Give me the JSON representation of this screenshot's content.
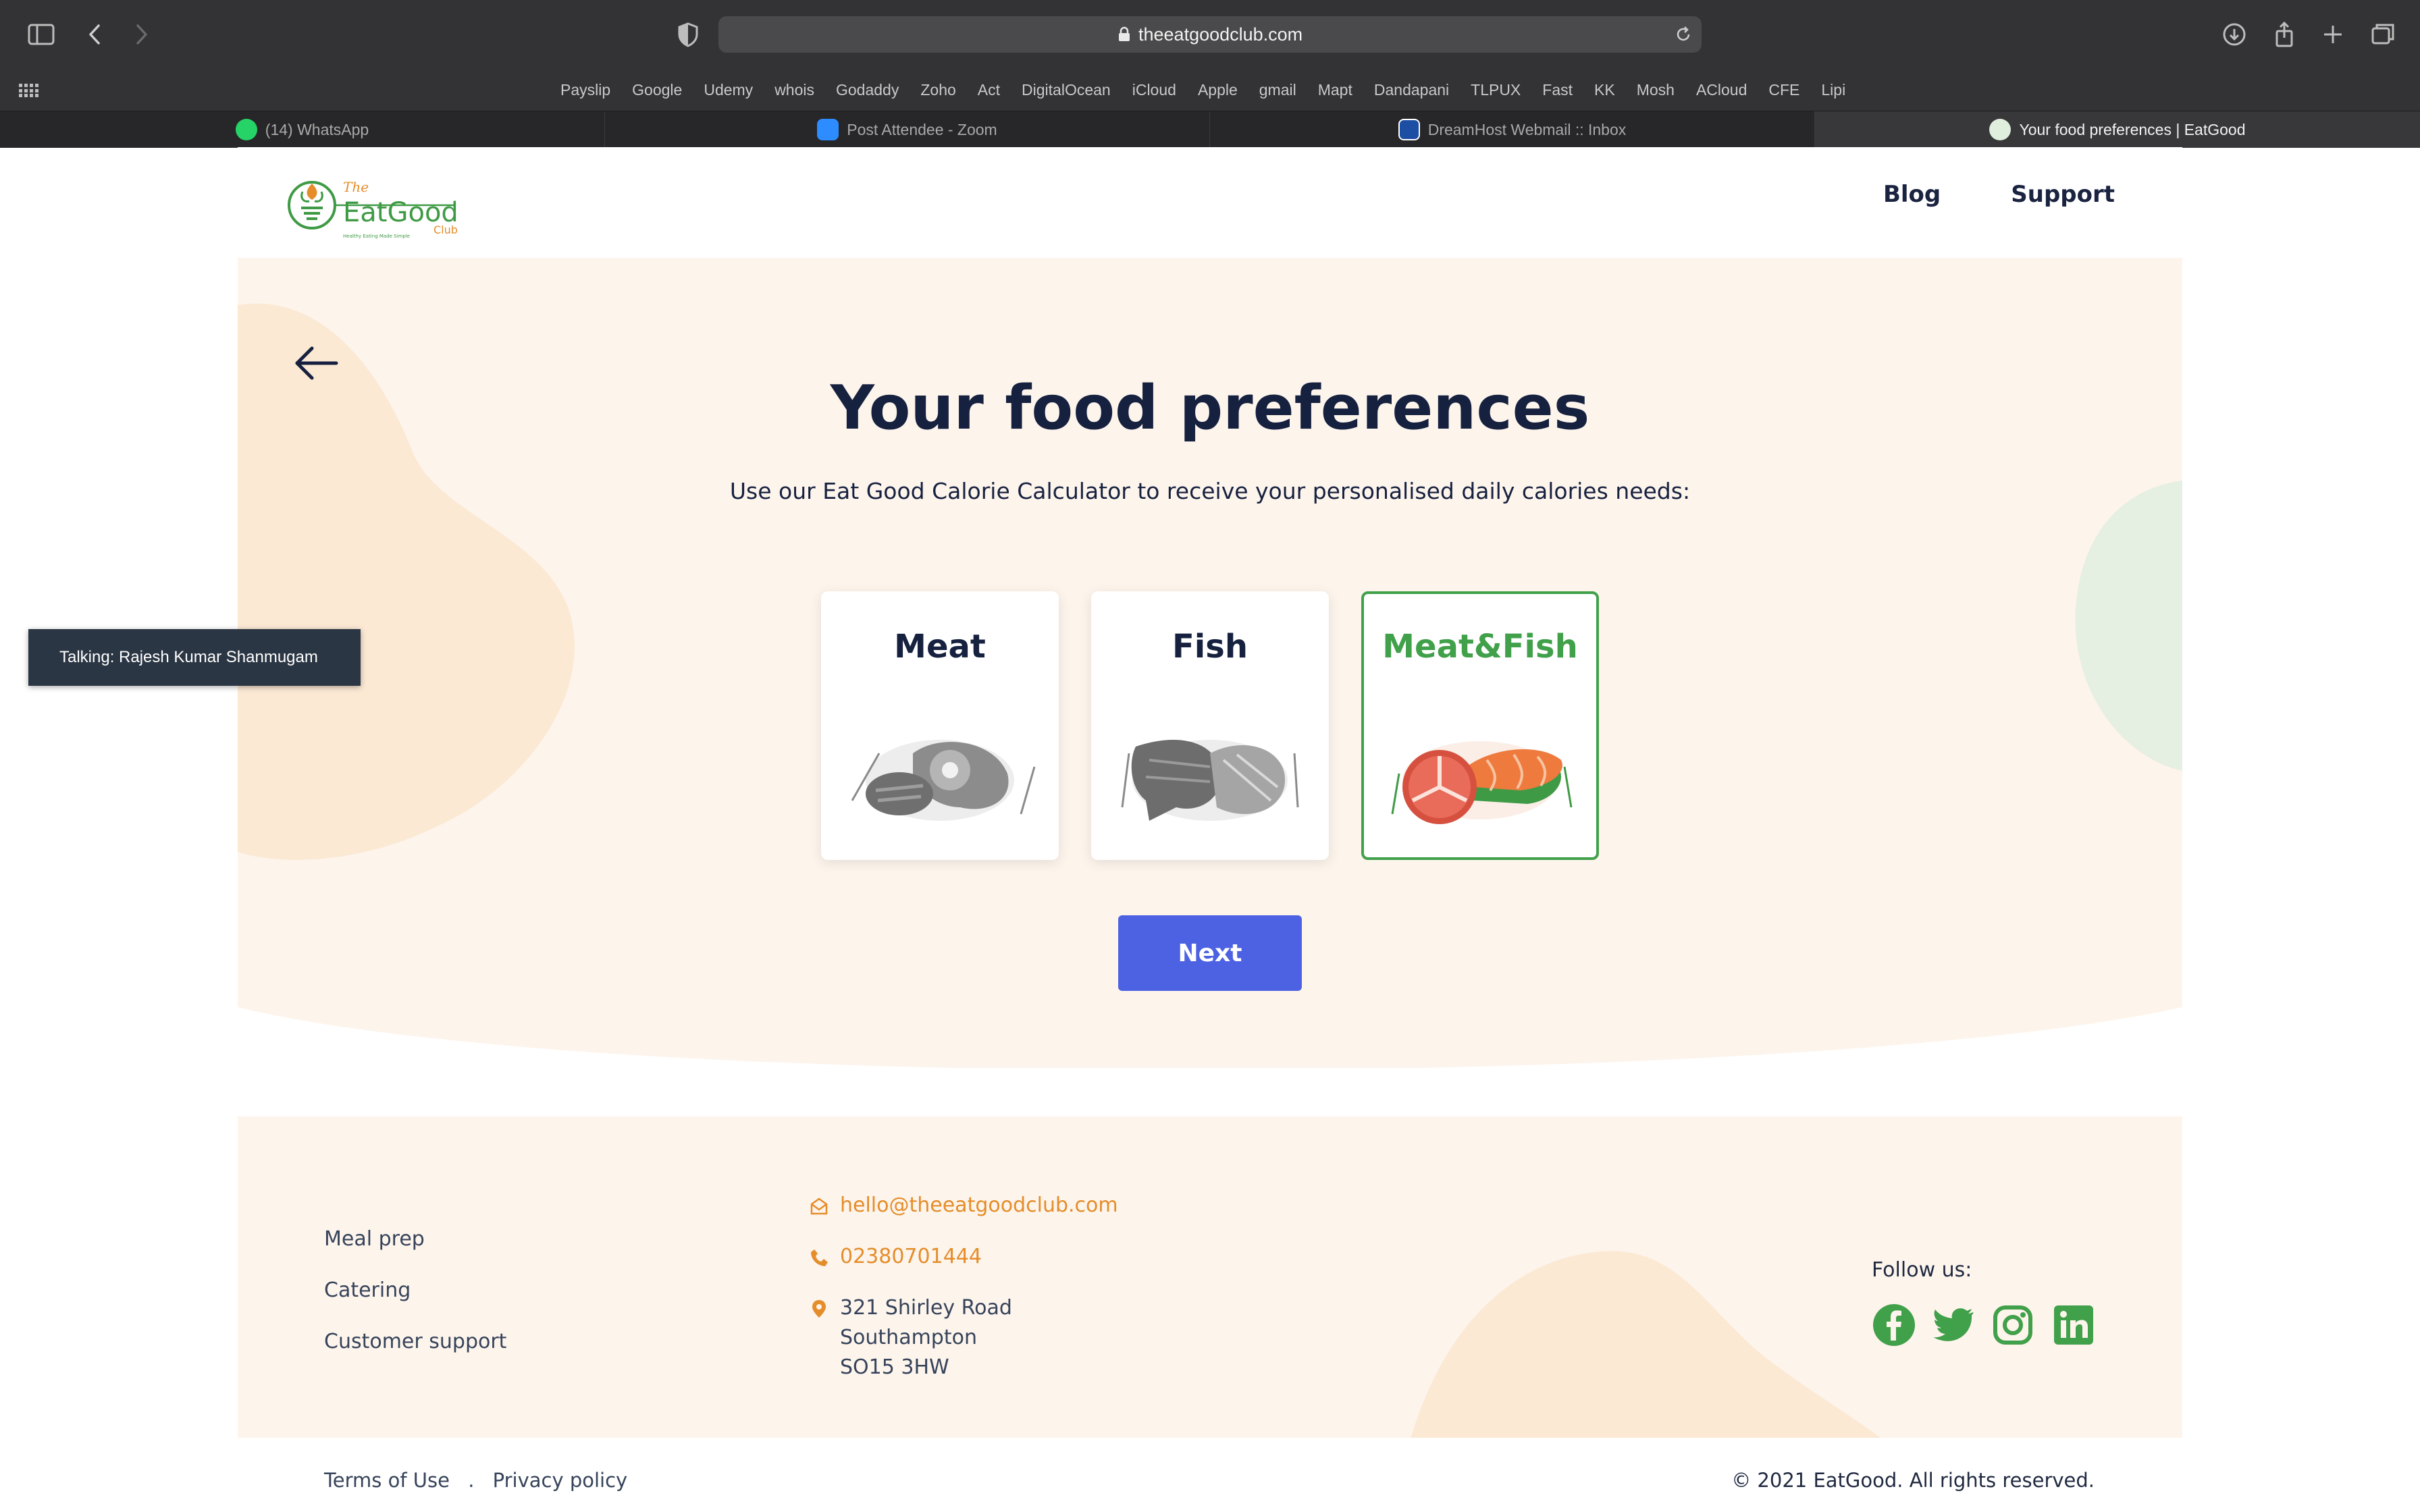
{
  "browser": {
    "url": "theeatgoodclub.com",
    "bookmarks": [
      "Payslip",
      "Google",
      "Udemy",
      "whois",
      "Godaddy",
      "Zoho",
      "Act",
      "DigitalOcean",
      "iCloud",
      "Apple",
      "gmail",
      "Mapt",
      "Dandapani",
      "TLPUX",
      "Fast",
      "KK",
      "Mosh",
      "ACloud",
      "CFE",
      "Lipi"
    ],
    "tabs": [
      {
        "label": "(14) WhatsApp",
        "icon": "whatsapp-icon"
      },
      {
        "label": "Post Attendee - Zoom",
        "icon": "zoom-icon"
      },
      {
        "label": "DreamHost Webmail :: Inbox",
        "icon": "dreamhost-icon"
      },
      {
        "label": "Your food preferences | EatGood",
        "icon": "eatgood-icon"
      }
    ]
  },
  "header": {
    "logo": {
      "the": "The",
      "name": "EatGood",
      "club": "Club",
      "tagline": "Healthy Eating Made Simple"
    },
    "nav": [
      "Blog",
      "Support"
    ]
  },
  "main": {
    "title": "Your food preferences",
    "subtitle": "Use our Eat Good Calorie Calculator to receive your personalised daily calories needs:",
    "options": [
      {
        "label": "Meat",
        "selected": false
      },
      {
        "label": "Fish",
        "selected": false
      },
      {
        "label": "Meat&Fish",
        "selected": true
      }
    ],
    "next_label": "Next"
  },
  "footer": {
    "links": [
      "Meal prep",
      "Catering",
      "Customer support"
    ],
    "email": "hello@theeatgoodclub.com",
    "phone": "02380701444",
    "address": [
      "321 Shirley Road",
      "Southampton",
      "SO15 3HW"
    ],
    "follow_label": "Follow us:",
    "social": [
      "facebook-icon",
      "twitter-icon",
      "instagram-icon",
      "linkedin-icon"
    ],
    "bottom_links": [
      "Terms of Use",
      "Privacy policy"
    ],
    "separator": ".",
    "copyright": "© 2021 EatGood. All rights reserved."
  },
  "overlay": {
    "talking": "Talking: Rajesh Kumar Shanmugam"
  },
  "colors": {
    "accent_green": "#41a04a",
    "button_blue": "#4c62e2",
    "heading_navy": "#16213f",
    "footer_orange": "#e58d2a",
    "hero_peach": "#fdf4ec"
  }
}
